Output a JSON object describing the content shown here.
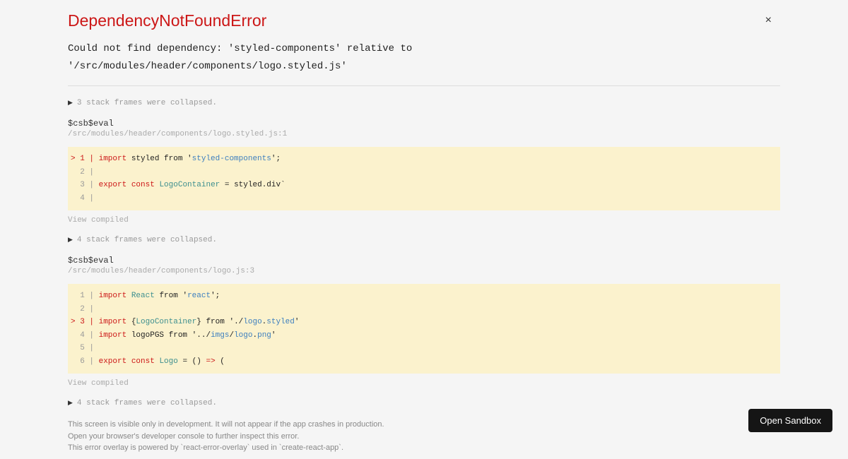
{
  "title": "DependencyNotFoundError",
  "message_line1": "Could not find dependency: 'styled-components' relative to",
  "message_line2": "'/src/modules/header/components/logo.styled.js'",
  "collapsed_1": "3 stack frames were collapsed.",
  "collapsed_2": "4 stack frames were collapsed.",
  "collapsed_3": "4 stack frames were collapsed.",
  "frame1": {
    "fn": "$csb$eval",
    "loc": "/src/modules/header/components/logo.styled.js:1",
    "lines": {
      "l1_gutter": "> 1 | ",
      "l1_import": "import",
      "l1_styled": " styled ",
      "l1_from": "from '",
      "l1_mod": "styled-components",
      "l1_end": "';",
      "l2": "  2 | ",
      "l3_gutter": "  3 | ",
      "l3_export": "export",
      "l3_sp": " ",
      "l3_const": "const",
      "l3_sp2": " ",
      "l3_name": "LogoContainer",
      "l3_rest": " = styled.div`",
      "l4": "  4 | "
    }
  },
  "frame2": {
    "fn": "$csb$eval",
    "loc": "/src/modules/header/components/logo.js:3",
    "lines": {
      "l1_gutter": "  1 | ",
      "l1_import": "import",
      "l1_sp": " ",
      "l1_react": "React",
      "l1_from": " from '",
      "l1_mod": "react",
      "l1_end": "';",
      "l2": "  2 | ",
      "l3_gutter": "> 3 | ",
      "l3_import": "import",
      "l3_sp": " {",
      "l3_name": "LogoContainer",
      "l3_rest": "} from '",
      "l3_dot": "./",
      "l3_logo": "logo",
      "l3_dot2": ".",
      "l3_styled": "styled",
      "l3_end": "'",
      "l4_gutter": "  4 | ",
      "l4_import": "import",
      "l4_rest": " logoPGS from '",
      "l4_dots": "../",
      "l4_imgs": "imgs",
      "l4_slash": "/",
      "l4_logo": "logo",
      "l4_dot": ".",
      "l4_png": "png",
      "l4_end": "'",
      "l5": "  5 | ",
      "l6_gutter": "  6 | ",
      "l6_export": "export",
      "l6_sp": " ",
      "l6_const": "const",
      "l6_sp2": " ",
      "l6_name": "Logo",
      "l6_eq": " = () ",
      "l6_arrow": "=>",
      "l6_rest": " ("
    }
  },
  "view_compiled": "View compiled",
  "footer1": "This screen is visible only in development. It will not appear if the app crashes in production.",
  "footer2": "Open your browser's developer console to further inspect this error.",
  "footer3": "This error overlay is powered by `react-error-overlay` used in `create-react-app`.",
  "close": "×",
  "open_sandbox": "Open Sandbox"
}
